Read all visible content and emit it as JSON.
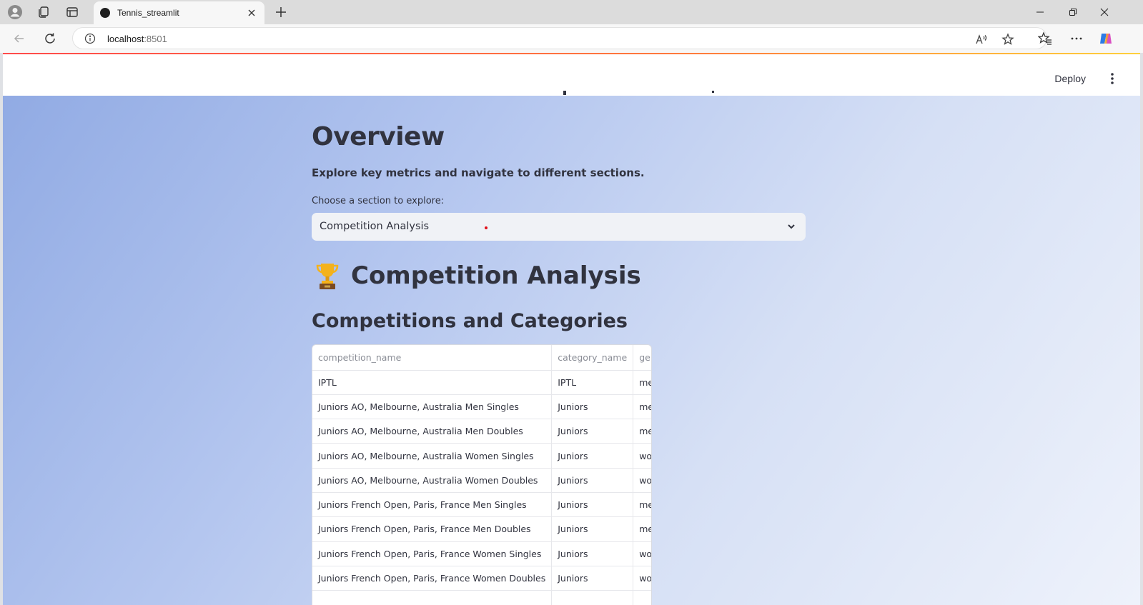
{
  "browser": {
    "tab_title": "Tennis_streamlit",
    "url_host": "localhost",
    "url_port": ":8501"
  },
  "header": {
    "deploy_label": "Deploy"
  },
  "main": {
    "overview_title": "Overview",
    "overview_subtitle": "Explore key metrics and navigate to different sections.",
    "select_label": "Choose a section to explore:",
    "select_value": "Competition Analysis",
    "section_title": "Competition Analysis",
    "section_icon": "trophy-icon",
    "table_title": "Competitions and Categories"
  },
  "table": {
    "columns": [
      "competition_name",
      "category_name",
      "gender"
    ],
    "rows": [
      [
        "IPTL",
        "IPTL",
        "men"
      ],
      [
        "Juniors AO, Melbourne, Australia Men Singles",
        "Juniors",
        "men"
      ],
      [
        "Juniors AO, Melbourne, Australia Men Doubles",
        "Juniors",
        "men"
      ],
      [
        "Juniors AO, Melbourne, Australia Women Singles",
        "Juniors",
        "women"
      ],
      [
        "Juniors AO, Melbourne, Australia Women Doubles",
        "Juniors",
        "women"
      ],
      [
        "Juniors French Open, Paris, France Men Singles",
        "Juniors",
        "men"
      ],
      [
        "Juniors French Open, Paris, France Men Doubles",
        "Juniors",
        "men"
      ],
      [
        "Juniors French Open, Paris, France Women Singles",
        "Juniors",
        "women"
      ],
      [
        "Juniors French Open, Paris, France Women Doubles",
        "Juniors",
        "women"
      ]
    ]
  },
  "colors": {
    "text": "#31333f",
    "select_bg": "#f0f2f6",
    "accent_red": "#ff4b4b"
  }
}
